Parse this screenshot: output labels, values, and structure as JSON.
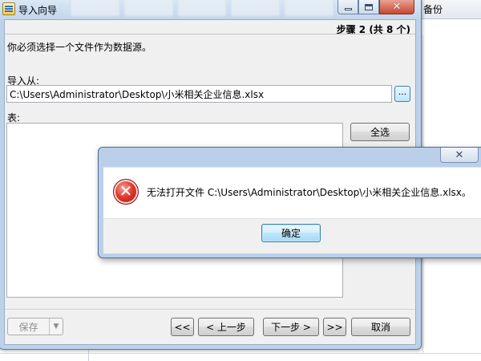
{
  "background_app": {
    "tab_label": "备份"
  },
  "wizard": {
    "title": "导入向导",
    "step_indicator": "步骤 2 (共 8 个)",
    "instruction": "你必须选择一个文件作为数据源。",
    "import_from_label": "导入从:",
    "import_path_value": "C:\\Users\\Administrator\\Desktop\\小米相关企业信息.xlsx",
    "browse_label": "...",
    "table_label": "表:",
    "select_all_label": "全选",
    "save_label": "保存",
    "first_label": "<<",
    "prev_label": "< 上一步",
    "next_label": "下一步 >",
    "last_label": ">>",
    "cancel_label": "取消"
  },
  "error_dialog": {
    "message": "无法打开文件 C:\\Users\\Administrator\\Desktop\\小米相关企业信息.xlsx。",
    "ok_label": "确定",
    "icon": "error-icon"
  }
}
